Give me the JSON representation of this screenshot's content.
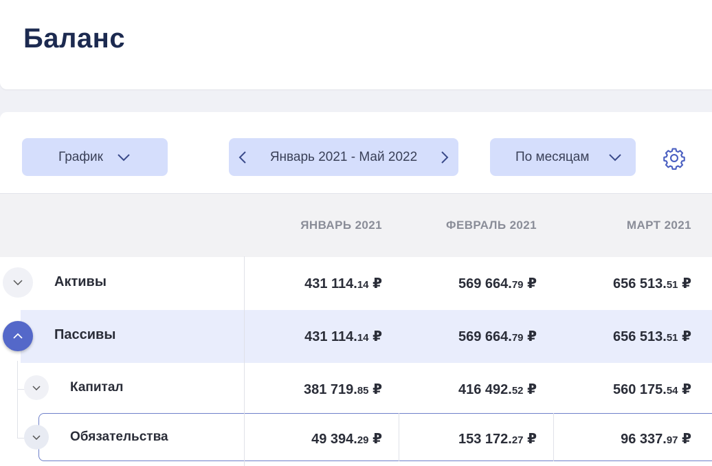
{
  "header": {
    "title": "Баланс"
  },
  "toolbar": {
    "chart_label": "График",
    "range_label": "Январь 2021 - Май 2022",
    "period_label": "По месяцам"
  },
  "table": {
    "columns": [
      "ЯНВАРЬ 2021",
      "ФЕВРАЛЬ 2021",
      "МАРТ 2021"
    ],
    "rows": [
      {
        "label": "Активы",
        "values": [
          {
            "int": "431 114.",
            "dec": "14",
            "cur": " ₽"
          },
          {
            "int": "569 664.",
            "dec": "79",
            "cur": " ₽"
          },
          {
            "int": "656 513.",
            "dec": "51",
            "cur": " ₽"
          }
        ]
      },
      {
        "label": "Пассивы",
        "values": [
          {
            "int": "431 114.",
            "dec": "14",
            "cur": " ₽"
          },
          {
            "int": "569 664.",
            "dec": "79",
            "cur": " ₽"
          },
          {
            "int": "656 513.",
            "dec": "51",
            "cur": " ₽"
          }
        ]
      },
      {
        "label": "Капитал",
        "values": [
          {
            "int": "381 719.",
            "dec": "85",
            "cur": " ₽"
          },
          {
            "int": "416 492.",
            "dec": "52",
            "cur": " ₽"
          },
          {
            "int": "560 175.",
            "dec": "54",
            "cur": " ₽"
          }
        ]
      },
      {
        "label": "Обязательства",
        "values": [
          {
            "int": "49 394.",
            "dec": "29",
            "cur": " ₽"
          },
          {
            "int": "153 172.",
            "dec": "27",
            "cur": " ₽"
          },
          {
            "int": "96 337.",
            "dec": "97",
            "cur": " ₽"
          }
        ]
      }
    ]
  },
  "colors": {
    "accent": "#5468c9",
    "button_bg": "#d5defc",
    "highlight_row": "#e9edfc",
    "title": "#1c2a50"
  },
  "icons": [
    "chevron-down-icon",
    "chevron-left-icon",
    "chevron-right-icon",
    "gear-icon",
    "chevron-up-icon"
  ]
}
